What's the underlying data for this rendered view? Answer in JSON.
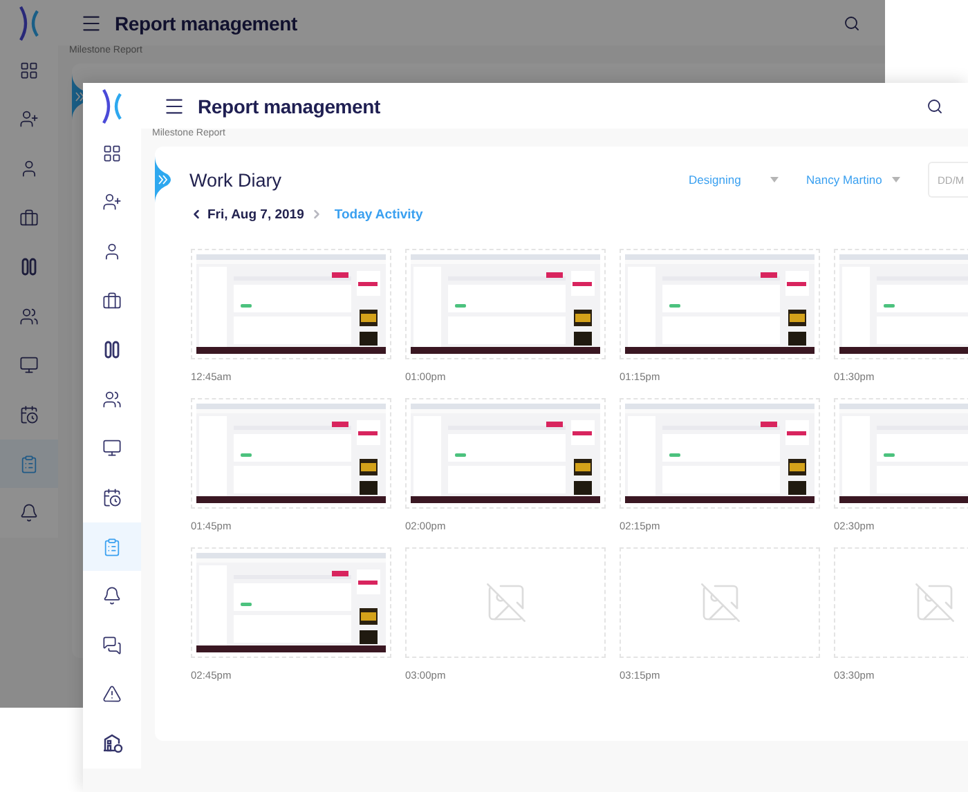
{
  "back_window": {
    "title": "Report management",
    "breadcrumb": "Milestone Report",
    "sidebar": [
      {
        "selected": false
      },
      {
        "selected": false
      },
      {
        "selected": false
      },
      {
        "selected": false
      },
      {
        "selected": false
      },
      {
        "selected": false
      },
      {
        "selected": false
      },
      {
        "selected": false
      },
      {
        "selected": true
      },
      {
        "selected": false
      }
    ]
  },
  "window": {
    "title": "Report management",
    "breadcrumb": "Milestone Report",
    "sidebar": [
      {
        "selected": false
      },
      {
        "selected": false
      },
      {
        "selected": false
      },
      {
        "selected": false
      },
      {
        "selected": false
      },
      {
        "selected": false
      },
      {
        "selected": false
      },
      {
        "selected": false
      },
      {
        "selected": true
      },
      {
        "selected": false
      },
      {
        "selected": false
      },
      {
        "selected": false
      },
      {
        "selected": false
      }
    ],
    "card": {
      "title": "Work Diary",
      "filters": [
        "Designing",
        "Nancy Martino"
      ],
      "date_field": {
        "placeholder": "DD/M"
      },
      "date": "Fri, Aug 7, 2019",
      "today_link": "Today Activity",
      "snapshots": [
        {
          "kind": "screenshot",
          "time": "12:45am"
        },
        {
          "kind": "screenshot",
          "time": "01:00pm"
        },
        {
          "kind": "screenshot",
          "time": "01:15pm"
        },
        {
          "kind": "screenshot",
          "time": "01:30pm"
        },
        {
          "kind": "screenshot",
          "time": "01:45pm"
        },
        {
          "kind": "screenshot",
          "time": "02:00pm"
        },
        {
          "kind": "screenshot",
          "time": "02:15pm"
        },
        {
          "kind": "screenshot",
          "time": "02:30pm"
        },
        {
          "kind": "screenshot",
          "time": "02:45pm"
        },
        {
          "kind": "empty",
          "time": "03:00pm"
        },
        {
          "kind": "empty",
          "time": "03:15pm"
        },
        {
          "kind": "empty",
          "time": "03:30pm"
        }
      ]
    }
  }
}
